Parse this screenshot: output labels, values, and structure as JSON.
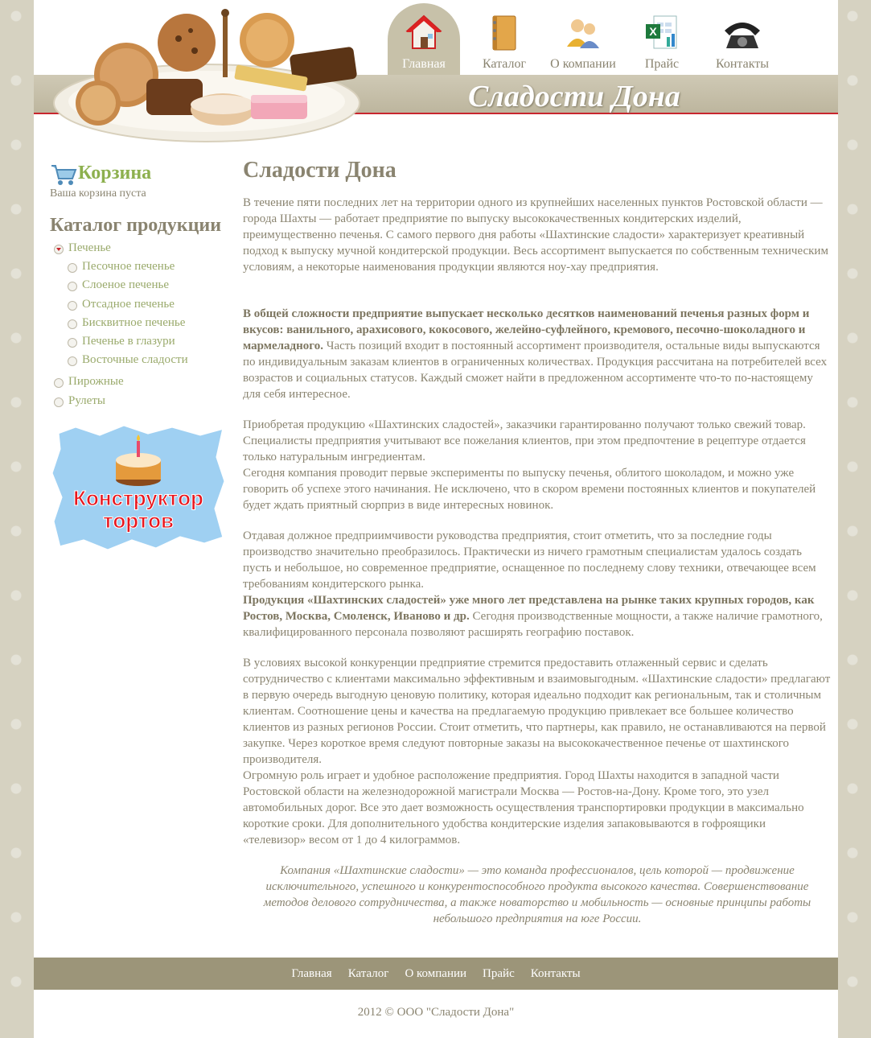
{
  "header": {
    "site_name": "Сладости Дона",
    "nav": [
      {
        "label": "Главная",
        "icon": "home-icon"
      },
      {
        "label": "Каталог",
        "icon": "catalog-book-icon"
      },
      {
        "label": "О компании",
        "icon": "people-icon"
      },
      {
        "label": "Прайс",
        "icon": "excel-icon"
      },
      {
        "label": "Контакты",
        "icon": "phone-icon"
      }
    ]
  },
  "sidebar": {
    "cart_title": "Корзина",
    "cart_status": "Ваша корзина пуста",
    "catalog_title": "Каталог продукции",
    "categories": [
      {
        "label": "Печенье",
        "open": true
      },
      {
        "label": "Песочное печенье",
        "sub": true
      },
      {
        "label": "Слоеное печенье",
        "sub": true
      },
      {
        "label": "Отсадное печенье",
        "sub": true
      },
      {
        "label": "Бисквитное печенье",
        "sub": true
      },
      {
        "label": "Печенье в глазури",
        "sub": true
      },
      {
        "label": "Восточные сладости",
        "sub": true
      },
      {
        "label": "Пирожные"
      },
      {
        "label": "Рулеты"
      }
    ],
    "banner_line1": "Конструктор",
    "banner_line2": "тортов"
  },
  "main": {
    "title": "Сладости Дона",
    "p1": "В течение пяти последних лет на территории одного из крупнейших населенных пунктов Ростовской области — города Шахты — работает предприятие по выпуску высококачественных кондитерских изделий, преимущественно печенья. С самого первого дня работы «Шахтинские сладости» характеризует креативный подход к выпуску мучной кондитерской продукции. Весь ассортимент выпускается по собственным техническим условиям, а некоторые наименования продукции являются ноу-хау предприятия.",
    "p2_bold": "В общей сложности предприятие выпускает несколько десятков наименований печенья разных форм и вкусов: ванильного, арахисового, кокосового, желейно-суфлейного, кремового, песочно-шоколадного и мармеладного.",
    "p2_rest": " Часть позиций входит в постоянный ассортимент производителя, остальные виды выпускаются по индивидуальным заказам клиентов в ограниченных количествах. Продукция рассчитана на потребителей всех возрастов и социальных статусов. Каждый сможет найти в предложенном ассортименте что-то по-настоящему для себя интересное.",
    "p3": "Приобретая продукцию «Шахтинских сладостей», заказчики гарантированно получают только свежий товар. Специалисты предприятия учитывают все пожелания клиентов, при этом предпочтение в рецептуре отдается только натуральным ингредиентам.",
    "p4": "Сегодня компания проводит первые эксперименты по выпуску печенья, облитого шоколадом, и можно уже говорить об успехе этого начинания. Не исключено, что в скором времени постоянных клиентов и покупателей будет ждать приятный сюрприз в виде интересных новинок.",
    "p5": "Отдавая должное предприимчивости руководства предприятия, стоит отметить, что за последние годы производство значительно преобразилось. Практически из ничего грамотным специалистам удалось создать пусть и небольшое, но современное предприятие, оснащенное по последнему слову техники, отвечающее всем требованиям кондитерского рынка.",
    "p6_bold": "Продукция «Шахтинских сладостей» уже много лет представлена на рынке таких крупных городов, как Ростов, Москва, Смоленск, Иваново и др.",
    "p6_rest": " Сегодня производственные мощности, а также наличие грамотного, квалифицированного персонала позволяют расширять географию поставок.",
    "p7": "В условиях высокой конкуренции предприятие стремится предоставить отлаженный сервис и сделать сотрудничество с клиентами максимально эффективным и взаимовыгодным. «Шахтинские сладости» предлагают в первую очередь выгодную ценовую политику, которая идеально подходит как региональным, так и столичным клиентам. Соотношение цены и качества на предлагаемую продукцию привлекает все большее количество клиентов из разных регионов России. Стоит отметить, что партнеры, как правило, не останавливаются на первой закупке. Через короткое время следуют повторные заказы на высококачественное печенье от шахтинского производителя.",
    "p8": "Огромную роль играет и удобное расположение предприятия. Город Шахты находится в западной части Ростовской области на железнодорожной магистрали Москва — Ростов-на-Дону. Кроме того, это узел автомобильных дорог. Все это дает возможность осуществления транспортировки продукции в максимально короткие сроки. Для дополнительного удобства кондитерские изделия запаковываются в гофроящики «телевизор» весом от 1 до 4 килограммов.",
    "quote": "Компания «Шахтинские сладости» — это команда профессионалов, цель которой — продвижение исключительного, успешного и конкурентоспособного продукта высокого качества. Совершенствование методов делового сотрудничества, а также новаторство и мобильность — основные принципы работы небольшого предприятия на юге России."
  },
  "footer": {
    "links": [
      "Главная",
      "Каталог",
      "О компании",
      "Прайс",
      "Контакты"
    ],
    "copyright": "2012 © ООО \"Сладости Дона\""
  },
  "colors": {
    "accent_green": "#8db04e",
    "header_band": "#c7c1a9",
    "footer_bar": "#9c9579",
    "red_line": "#c8262e"
  }
}
